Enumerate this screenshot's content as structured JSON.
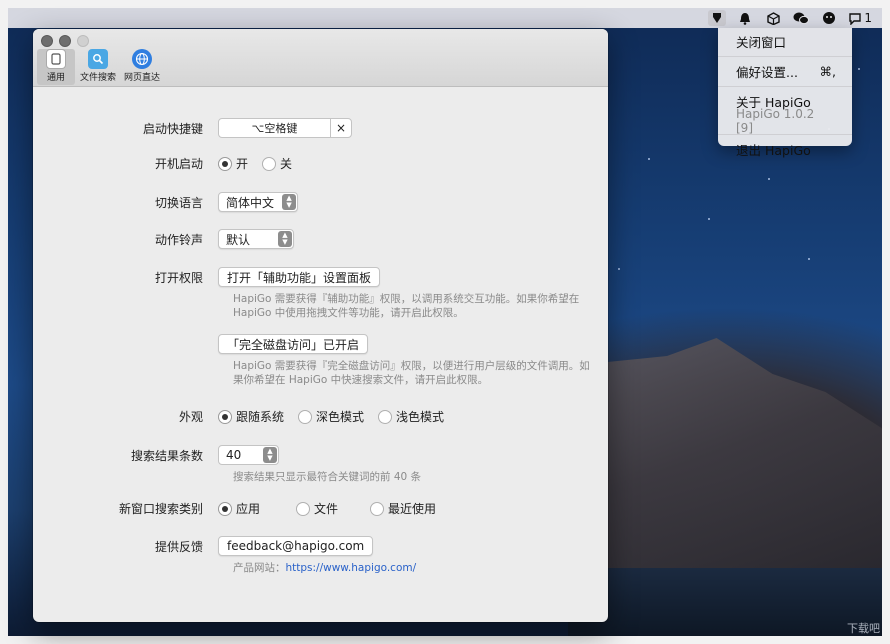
{
  "menubar": {
    "icons": [
      "hapigo-icon",
      "bell-icon",
      "box-icon",
      "wechat-icon",
      "face-icon"
    ],
    "badge": "1"
  },
  "dropdown": {
    "close_window": "关闭窗口",
    "preferences": "偏好设置...",
    "preferences_shortcut": "⌘,",
    "about": "关于 HapiGo",
    "version": "HapiGo 1.0.2 [9]",
    "quit": "退出 HapiGo"
  },
  "tabs": [
    {
      "label": "通用",
      "icon": "general-icon"
    },
    {
      "label": "文件搜索",
      "icon": "file-search-icon"
    },
    {
      "label": "网页直达",
      "icon": "globe-icon"
    }
  ],
  "settings": {
    "hotkey": {
      "label": "启动快捷键",
      "value": "⌥空格键",
      "clear": "×"
    },
    "launch_at_login": {
      "label": "开机启动",
      "on": "开",
      "off": "关",
      "selected": "开"
    },
    "language": {
      "label": "切换语言",
      "value": "简体中文"
    },
    "sound": {
      "label": "动作铃声",
      "value": "默认"
    },
    "permissions": {
      "label": "打开权限",
      "accessibility_button": "打开「辅助功能」设置面板",
      "accessibility_help": "HapiGo 需要获得『辅助功能』权限，以调用系统交互功能。如果你希望在 HapiGo 中使用拖拽文件等功能，请开启此权限。",
      "disk_button": "「完全磁盘访问」已开启",
      "disk_help": "HapiGo 需要获得『完全磁盘访问』权限，以便进行用户层级的文件调用。如果你希望在 HapiGo 中快速搜索文件，请开启此权限。"
    },
    "appearance": {
      "label": "外观",
      "options": [
        "跟随系统",
        "深色模式",
        "浅色模式"
      ],
      "selected": "跟随系统"
    },
    "result_count": {
      "label": "搜索结果条数",
      "value": "40",
      "help": "搜索结果只显示最符合关键词的前 40 条"
    },
    "new_window_category": {
      "label": "新窗口搜索类别",
      "options": [
        "应用",
        "文件",
        "最近使用"
      ],
      "selected": "应用"
    },
    "feedback": {
      "label": "提供反馈",
      "email": "feedback@hapigo.com",
      "site_label": "产品网站：",
      "site_url": "https://www.hapigo.com/"
    }
  },
  "watermark": "下载吧"
}
